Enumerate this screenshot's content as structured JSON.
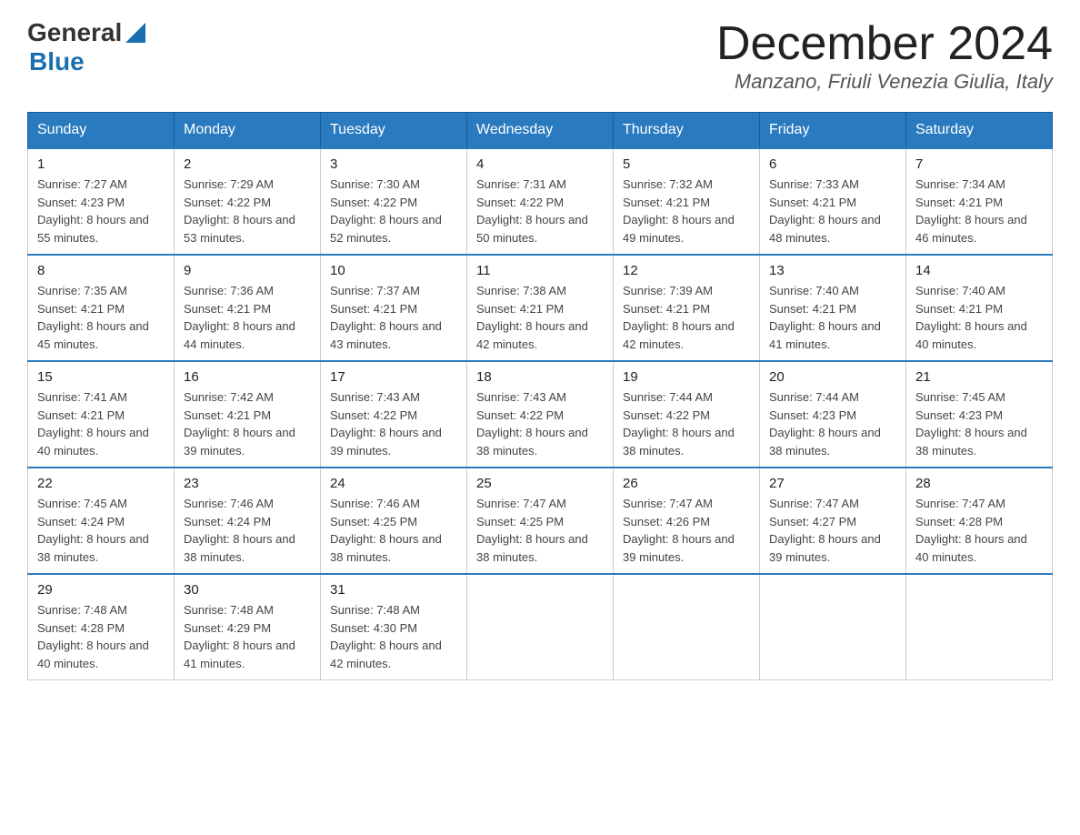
{
  "header": {
    "logo_general": "General",
    "logo_blue": "Blue",
    "month_title": "December 2024",
    "subtitle": "Manzano, Friuli Venezia Giulia, Italy"
  },
  "days_of_week": [
    "Sunday",
    "Monday",
    "Tuesday",
    "Wednesday",
    "Thursday",
    "Friday",
    "Saturday"
  ],
  "weeks": [
    [
      {
        "day": "1",
        "sunrise": "7:27 AM",
        "sunset": "4:23 PM",
        "daylight": "8 hours and 55 minutes."
      },
      {
        "day": "2",
        "sunrise": "7:29 AM",
        "sunset": "4:22 PM",
        "daylight": "8 hours and 53 minutes."
      },
      {
        "day": "3",
        "sunrise": "7:30 AM",
        "sunset": "4:22 PM",
        "daylight": "8 hours and 52 minutes."
      },
      {
        "day": "4",
        "sunrise": "7:31 AM",
        "sunset": "4:22 PM",
        "daylight": "8 hours and 50 minutes."
      },
      {
        "day": "5",
        "sunrise": "7:32 AM",
        "sunset": "4:21 PM",
        "daylight": "8 hours and 49 minutes."
      },
      {
        "day": "6",
        "sunrise": "7:33 AM",
        "sunset": "4:21 PM",
        "daylight": "8 hours and 48 minutes."
      },
      {
        "day": "7",
        "sunrise": "7:34 AM",
        "sunset": "4:21 PM",
        "daylight": "8 hours and 46 minutes."
      }
    ],
    [
      {
        "day": "8",
        "sunrise": "7:35 AM",
        "sunset": "4:21 PM",
        "daylight": "8 hours and 45 minutes."
      },
      {
        "day": "9",
        "sunrise": "7:36 AM",
        "sunset": "4:21 PM",
        "daylight": "8 hours and 44 minutes."
      },
      {
        "day": "10",
        "sunrise": "7:37 AM",
        "sunset": "4:21 PM",
        "daylight": "8 hours and 43 minutes."
      },
      {
        "day": "11",
        "sunrise": "7:38 AM",
        "sunset": "4:21 PM",
        "daylight": "8 hours and 42 minutes."
      },
      {
        "day": "12",
        "sunrise": "7:39 AM",
        "sunset": "4:21 PM",
        "daylight": "8 hours and 42 minutes."
      },
      {
        "day": "13",
        "sunrise": "7:40 AM",
        "sunset": "4:21 PM",
        "daylight": "8 hours and 41 minutes."
      },
      {
        "day": "14",
        "sunrise": "7:40 AM",
        "sunset": "4:21 PM",
        "daylight": "8 hours and 40 minutes."
      }
    ],
    [
      {
        "day": "15",
        "sunrise": "7:41 AM",
        "sunset": "4:21 PM",
        "daylight": "8 hours and 40 minutes."
      },
      {
        "day": "16",
        "sunrise": "7:42 AM",
        "sunset": "4:21 PM",
        "daylight": "8 hours and 39 minutes."
      },
      {
        "day": "17",
        "sunrise": "7:43 AM",
        "sunset": "4:22 PM",
        "daylight": "8 hours and 39 minutes."
      },
      {
        "day": "18",
        "sunrise": "7:43 AM",
        "sunset": "4:22 PM",
        "daylight": "8 hours and 38 minutes."
      },
      {
        "day": "19",
        "sunrise": "7:44 AM",
        "sunset": "4:22 PM",
        "daylight": "8 hours and 38 minutes."
      },
      {
        "day": "20",
        "sunrise": "7:44 AM",
        "sunset": "4:23 PM",
        "daylight": "8 hours and 38 minutes."
      },
      {
        "day": "21",
        "sunrise": "7:45 AM",
        "sunset": "4:23 PM",
        "daylight": "8 hours and 38 minutes."
      }
    ],
    [
      {
        "day": "22",
        "sunrise": "7:45 AM",
        "sunset": "4:24 PM",
        "daylight": "8 hours and 38 minutes."
      },
      {
        "day": "23",
        "sunrise": "7:46 AM",
        "sunset": "4:24 PM",
        "daylight": "8 hours and 38 minutes."
      },
      {
        "day": "24",
        "sunrise": "7:46 AM",
        "sunset": "4:25 PM",
        "daylight": "8 hours and 38 minutes."
      },
      {
        "day": "25",
        "sunrise": "7:47 AM",
        "sunset": "4:25 PM",
        "daylight": "8 hours and 38 minutes."
      },
      {
        "day": "26",
        "sunrise": "7:47 AM",
        "sunset": "4:26 PM",
        "daylight": "8 hours and 39 minutes."
      },
      {
        "day": "27",
        "sunrise": "7:47 AM",
        "sunset": "4:27 PM",
        "daylight": "8 hours and 39 minutes."
      },
      {
        "day": "28",
        "sunrise": "7:47 AM",
        "sunset": "4:28 PM",
        "daylight": "8 hours and 40 minutes."
      }
    ],
    [
      {
        "day": "29",
        "sunrise": "7:48 AM",
        "sunset": "4:28 PM",
        "daylight": "8 hours and 40 minutes."
      },
      {
        "day": "30",
        "sunrise": "7:48 AM",
        "sunset": "4:29 PM",
        "daylight": "8 hours and 41 minutes."
      },
      {
        "day": "31",
        "sunrise": "7:48 AM",
        "sunset": "4:30 PM",
        "daylight": "8 hours and 42 minutes."
      },
      null,
      null,
      null,
      null
    ]
  ]
}
